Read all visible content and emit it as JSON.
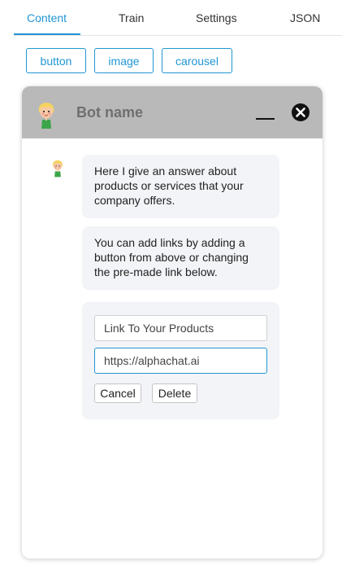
{
  "tabs": [
    {
      "label": "Content",
      "active": true
    },
    {
      "label": "Train",
      "active": false
    },
    {
      "label": "Settings",
      "active": false
    },
    {
      "label": "JSON",
      "active": false
    }
  ],
  "element_buttons": {
    "button": "button",
    "image": "image",
    "carousel": "carousel"
  },
  "chat": {
    "bot_name": "Bot name",
    "messages": [
      "Here I give an answer about products or services that your company offers.",
      "You can add links by adding a button from above or changing the pre-made link below."
    ],
    "link_card": {
      "title_value": "Link To Your Products",
      "url_value": "https://alphachat.ai",
      "cancel_label": "Cancel",
      "delete_label": "Delete"
    }
  },
  "colors": {
    "accent": "#2196d3",
    "header_bg": "#b9b9b9",
    "bubble_bg": "#f2f4f7"
  },
  "icons": [
    "bot-avatar-icon",
    "minimize-icon",
    "close-icon"
  ]
}
